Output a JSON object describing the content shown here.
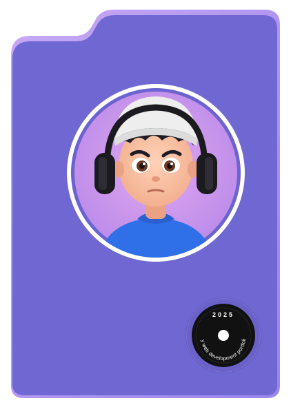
{
  "badge": {
    "year": "2025",
    "caption": "my web development portfolio"
  },
  "colors": {
    "folder_body": "#7068d2",
    "folder_tab_edge": "#b79af0",
    "avatar_bg": "#d89af0",
    "badge_disc": "#111111",
    "sweater": "#2f6fe8",
    "beanie": "#eeeeee"
  },
  "icons": [
    "folder-card",
    "avatar-illustration",
    "headphones-icon",
    "vinyl-badge-icon"
  ]
}
